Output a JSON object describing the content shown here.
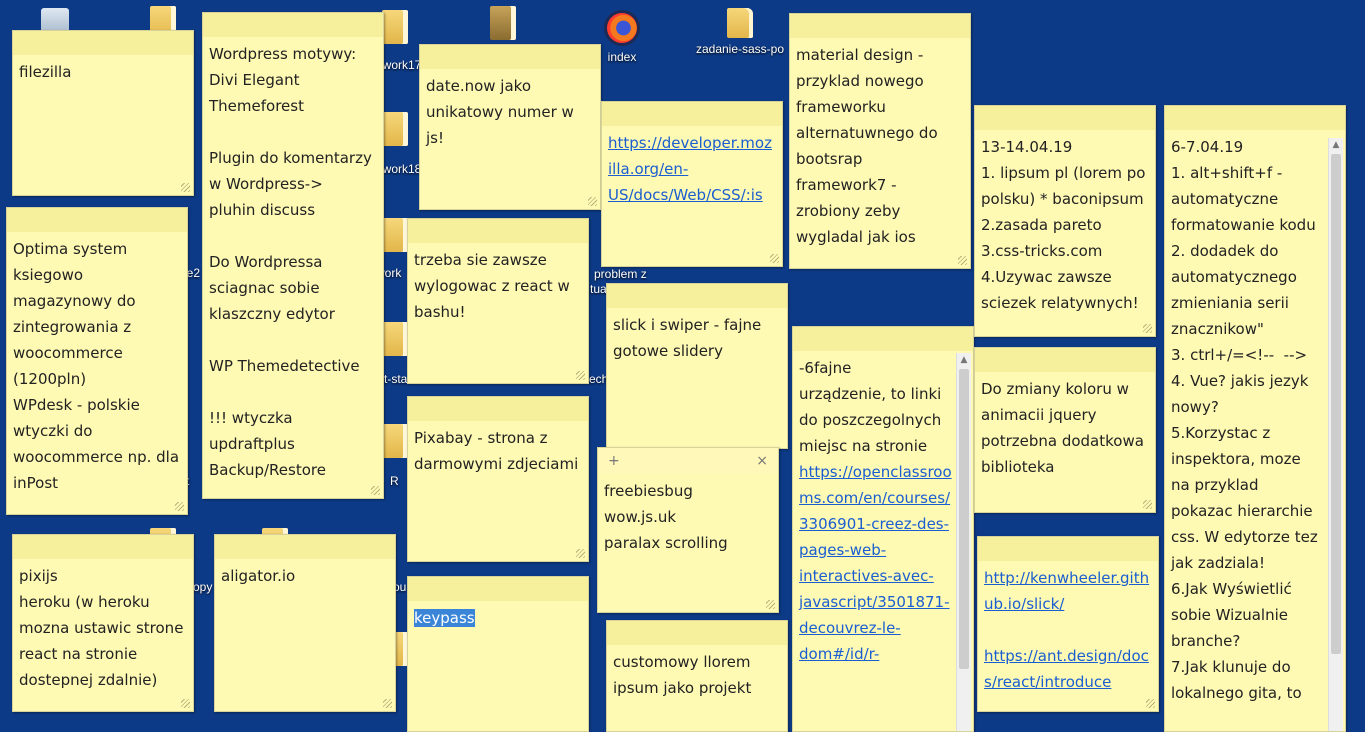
{
  "desktop": {
    "icons": [
      {
        "label": "index",
        "icon": "firefox-icon"
      },
      {
        "label": "zadanie-sass-po",
        "icon": "folder-icon"
      }
    ],
    "partial_labels": [
      "ework17",
      "ework18",
      "work",
      "ie2",
      "R",
      "opy",
      "ou",
      "ct-sta",
      "tual",
      "problem z",
      "echw",
      "t"
    ]
  },
  "notes": {
    "filezilla": {
      "text": "filezilla"
    },
    "wordpress": {
      "text": "Wordpress motywy:\nDivi Elegant\nThemeforest\n\nPlugin do komentarzy\nw Wordpress->\npluhin discuss\n\nDo Wordpressa\nsciagnac sobie\nklaszczny edytor\n\nWP Themedetective\n\n!!! wtyczka\nupdraftplus\nBackup/Restore"
    },
    "optima": {
      "text": "Optima system\nksiegowo\nmagazynowy do\nzintegrowania z\nwoocommerce\n(1200pln)\nWPdesk - polskie\nwtyczki do\nwoocommerce np. dla\ninPost"
    },
    "datenow": {
      "text": "date.now jako\nunikatowy numer w\njs!"
    },
    "react_bash": {
      "text": "trzeba sie zawsze\nwylogowac z react w\nbashu!"
    },
    "pixabay": {
      "text": "Pixabay - strona z\ndarmowymi zdjeciami"
    },
    "mdn": {
      "link": "https://developer.mozilla.org/en-US/docs/Web/CSS/:is"
    },
    "slick_swiper": {
      "text": "slick i swiper - fajne\ngotowe slidery"
    },
    "freebies": {
      "text": "freebiesbug\nwow.js.uk\nparalax scrolling",
      "add": "+",
      "close": "×"
    },
    "material": {
      "text": "material design -\nprzyklad nowego\nframeworku\nalternatuwnego do\nbootsrap\nframework7 -\nzrobiony zeby\nwygladal jak ios"
    },
    "fajne": {
      "text": "-6fajne\nurządzenie, to linki\ndo poszczegolnych\nmiejsc na stronie\n",
      "link": "https://openclassrooms.com/en/courses/3306901-creez-des-pages-web-interactives-avec-javascript/3501871-decouvrez-le-dom#/id/r-"
    },
    "dates1": {
      "text": "13-14.04.19\n1. lipsum pl (lorem po\npolsku) * baconipsum\n2.zasada pareto\n3.css-tricks.com\n4.Uzywac zawsze\nsciezek relatywnych!"
    },
    "kolor": {
      "text": "Do zmiany koloru w\nanimacii jquery\npotrzebna dodatkowa\nbiblioteka"
    },
    "links": {
      "link1": "http://kenwheeler.github.io/slick/",
      "link2": "https://ant.design/docs/react/introduce"
    },
    "dates2": {
      "text": "6-7.04.19\n1. alt+shift+f -\nautomatyczne\nformatowanie kodu\n2. dodadek do\nautomatycznego\nzmieniania serii\nznacznikow\"\n3. ctrl+/=<!--  -->\n4. Vue? jakis jezyk\nnowy?\n5.Korzystac z\ninspektora, moze\nna przyklad\npokazac hierarchie\ncss. W edytorze tez\njak zadziala!\n6.Jak Wyświetlić\nsobie Wizualnie\nbranche?\n7.Jak klunuje do\nlokalnego gita, to"
    },
    "pixijs": {
      "text": "pixijs\nheroku (w heroku\nmozna ustawic strone\nreact na stronie\ndostepnej zdalnie)"
    },
    "aligator": {
      "text": "aligator.io"
    },
    "keypass": {
      "text": "keypass"
    },
    "customowy": {
      "text": "customowy llorem\nipsum jako projekt"
    }
  }
}
